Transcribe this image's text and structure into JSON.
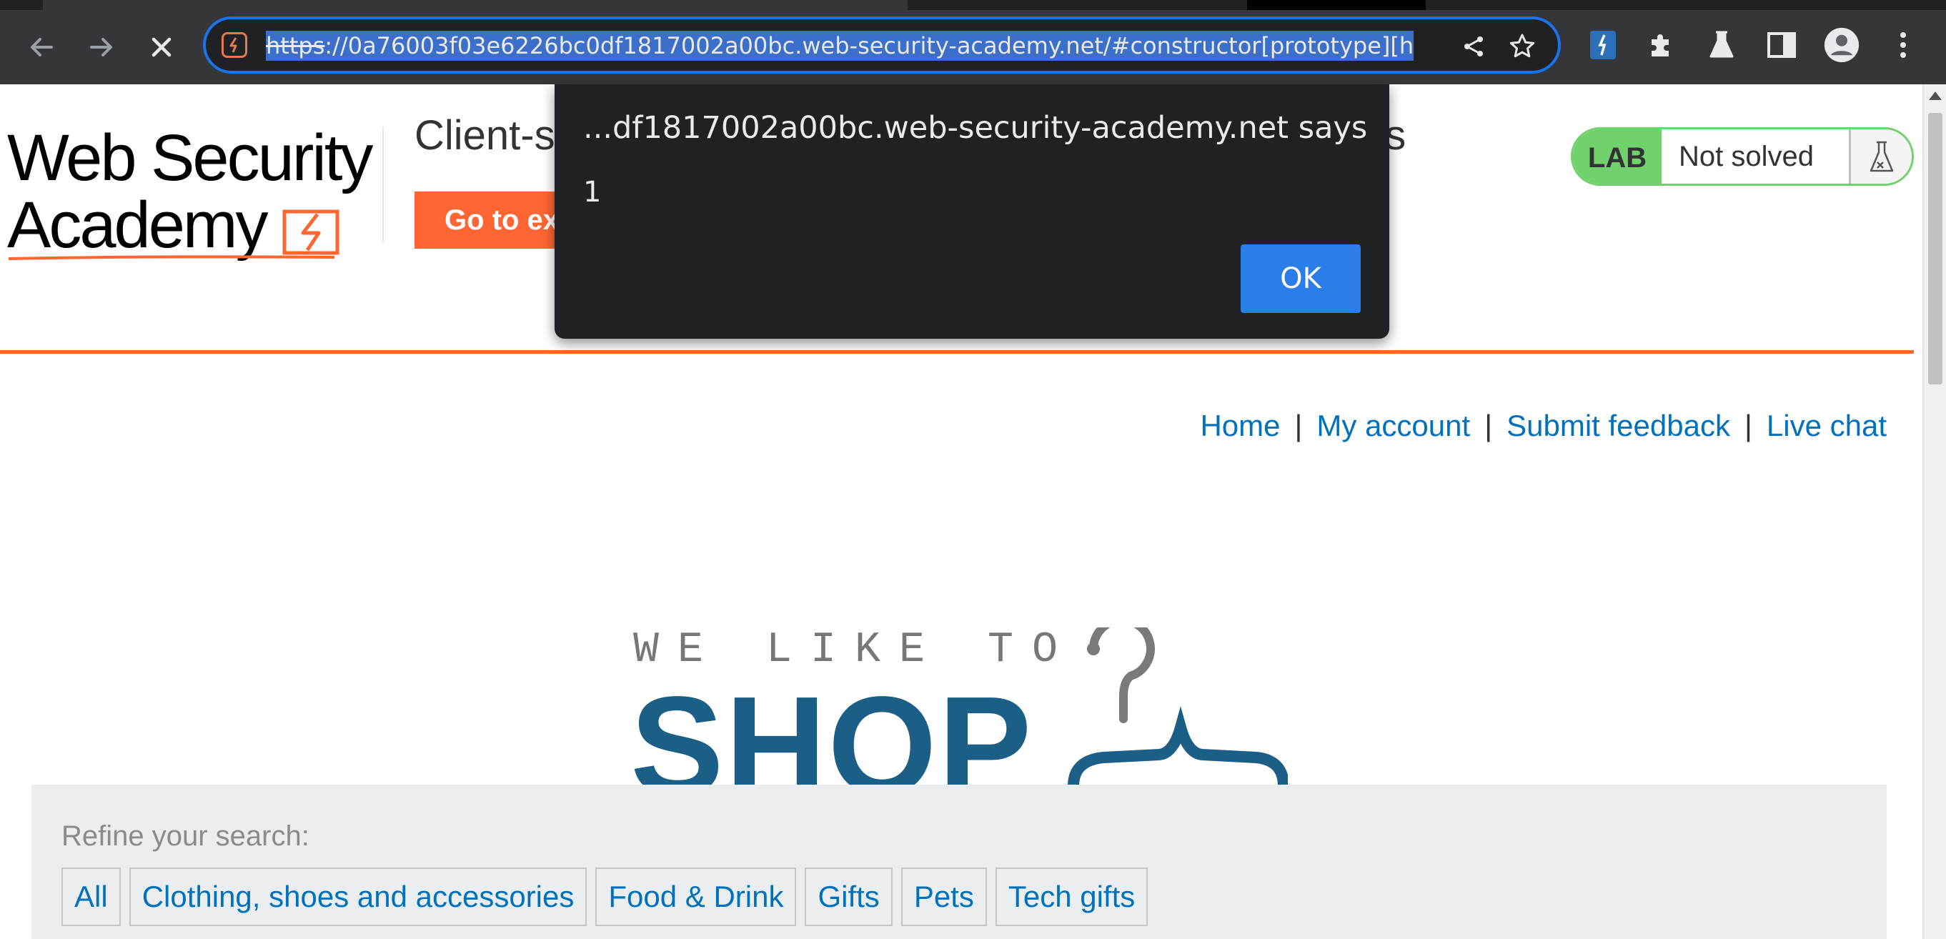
{
  "browser": {
    "url_scheme": "https",
    "url_rest": "://0a76003f03e6226bc0df1817002a00bc.web-security-academy.net/#constructor[prototype][h",
    "icons": [
      "back-icon",
      "forward-icon",
      "stop-icon",
      "share-icon",
      "bookmark-star-icon",
      "extension-icons",
      "profile-icon",
      "menu-icon"
    ]
  },
  "header": {
    "logo_line1": "Web Security",
    "logo_line2": "Academy",
    "lab_title": "Client-side prototype pollution via browser APIs",
    "lab_title_visible_left": "Client-s",
    "lab_title_visible_right": "es",
    "back_button_label": "Go to exploit server",
    "back_button_visible": "Go to ex",
    "lab_tag": "LAB",
    "lab_status": "Not solved"
  },
  "nav": {
    "home": "Home",
    "account": "My account",
    "feedback": "Submit feedback",
    "chat": "Live chat",
    "separator": "|"
  },
  "banner": {
    "line1": "WE LIKE TO",
    "line2": "SHOP",
    "brand_color": "#1b5e86"
  },
  "filters": {
    "label": "Refine your search:",
    "items": [
      "All",
      "Clothing, shoes and accessories",
      "Food & Drink",
      "Gifts",
      "Pets",
      "Tech gifts"
    ]
  },
  "alert": {
    "origin": "...df1817002a00bc.web-security-academy.net says",
    "message": "1",
    "ok_label": "OK"
  },
  "colors": {
    "accent": "#ff6633",
    "link": "#0071bc",
    "lab_green": "#70d16d",
    "focus_blue": "#1a73e8"
  }
}
